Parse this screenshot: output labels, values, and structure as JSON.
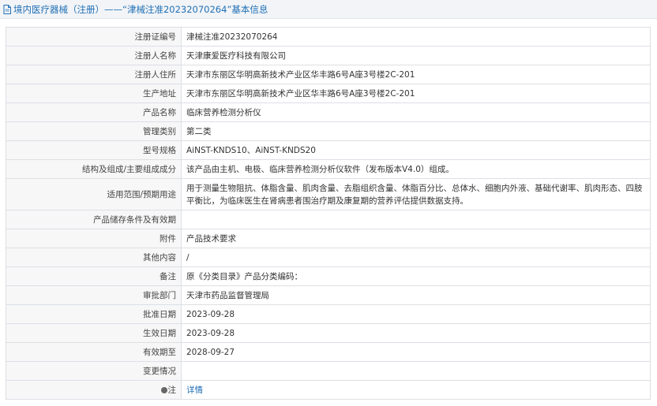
{
  "header": {
    "title": "境内医疗器械（注册）——“津械注准20232070264”基本信息"
  },
  "rows": [
    {
      "label": "注册证编号",
      "value": "津械注准20232070264"
    },
    {
      "label": "注册人名称",
      "value": "天津康爱医疗科技有限公司"
    },
    {
      "label": "注册人住所",
      "value": "天津市东丽区华明高新技术产业区华丰路6号A座3号楼2C-201"
    },
    {
      "label": "生产地址",
      "value": "天津市东丽区华明高新技术产业区华丰路6号A座3号楼2C-201"
    },
    {
      "label": "产品名称",
      "value": "临床营养检测分析仪"
    },
    {
      "label": "管理类别",
      "value": "第二类"
    },
    {
      "label": "型号规格",
      "value": "AiNST-KNDS10、AiNST-KNDS20"
    },
    {
      "label": "结构及组成/主要组成成分",
      "value": "该产品由主机、电极、临床营养检测分析仪软件（发布版本V4.0）组成。"
    },
    {
      "label": "适用范围/预期用途",
      "value": "用于测量生物阻抗、体脂含量、肌肉含量、去脂组织含量、体脂百分比、总体水、细胞内外液、基础代谢率、肌肉形态、四肢平衡比，为临床医生在肾病患者围治疗期及康复期的营养评估提供数据支持。"
    },
    {
      "label": "产品储存条件及有效期",
      "value": ""
    },
    {
      "label": "附件",
      "value": "产品技术要求"
    },
    {
      "label": "其他内容",
      "value": "/"
    },
    {
      "label": "备注",
      "value": "原《分类目录》产品分类编码："
    },
    {
      "label": "审批部门",
      "value": "天津市药品监督管理局"
    },
    {
      "label": "批准日期",
      "value": "2023-09-28"
    },
    {
      "label": "生效日期",
      "value": "2023-09-28"
    },
    {
      "label": "有效期至",
      "value": "2028-09-27"
    },
    {
      "label": "变更情况",
      "value": ""
    }
  ],
  "note_row": {
    "label": "注",
    "link": "详情",
    "icon": "note-icon"
  }
}
